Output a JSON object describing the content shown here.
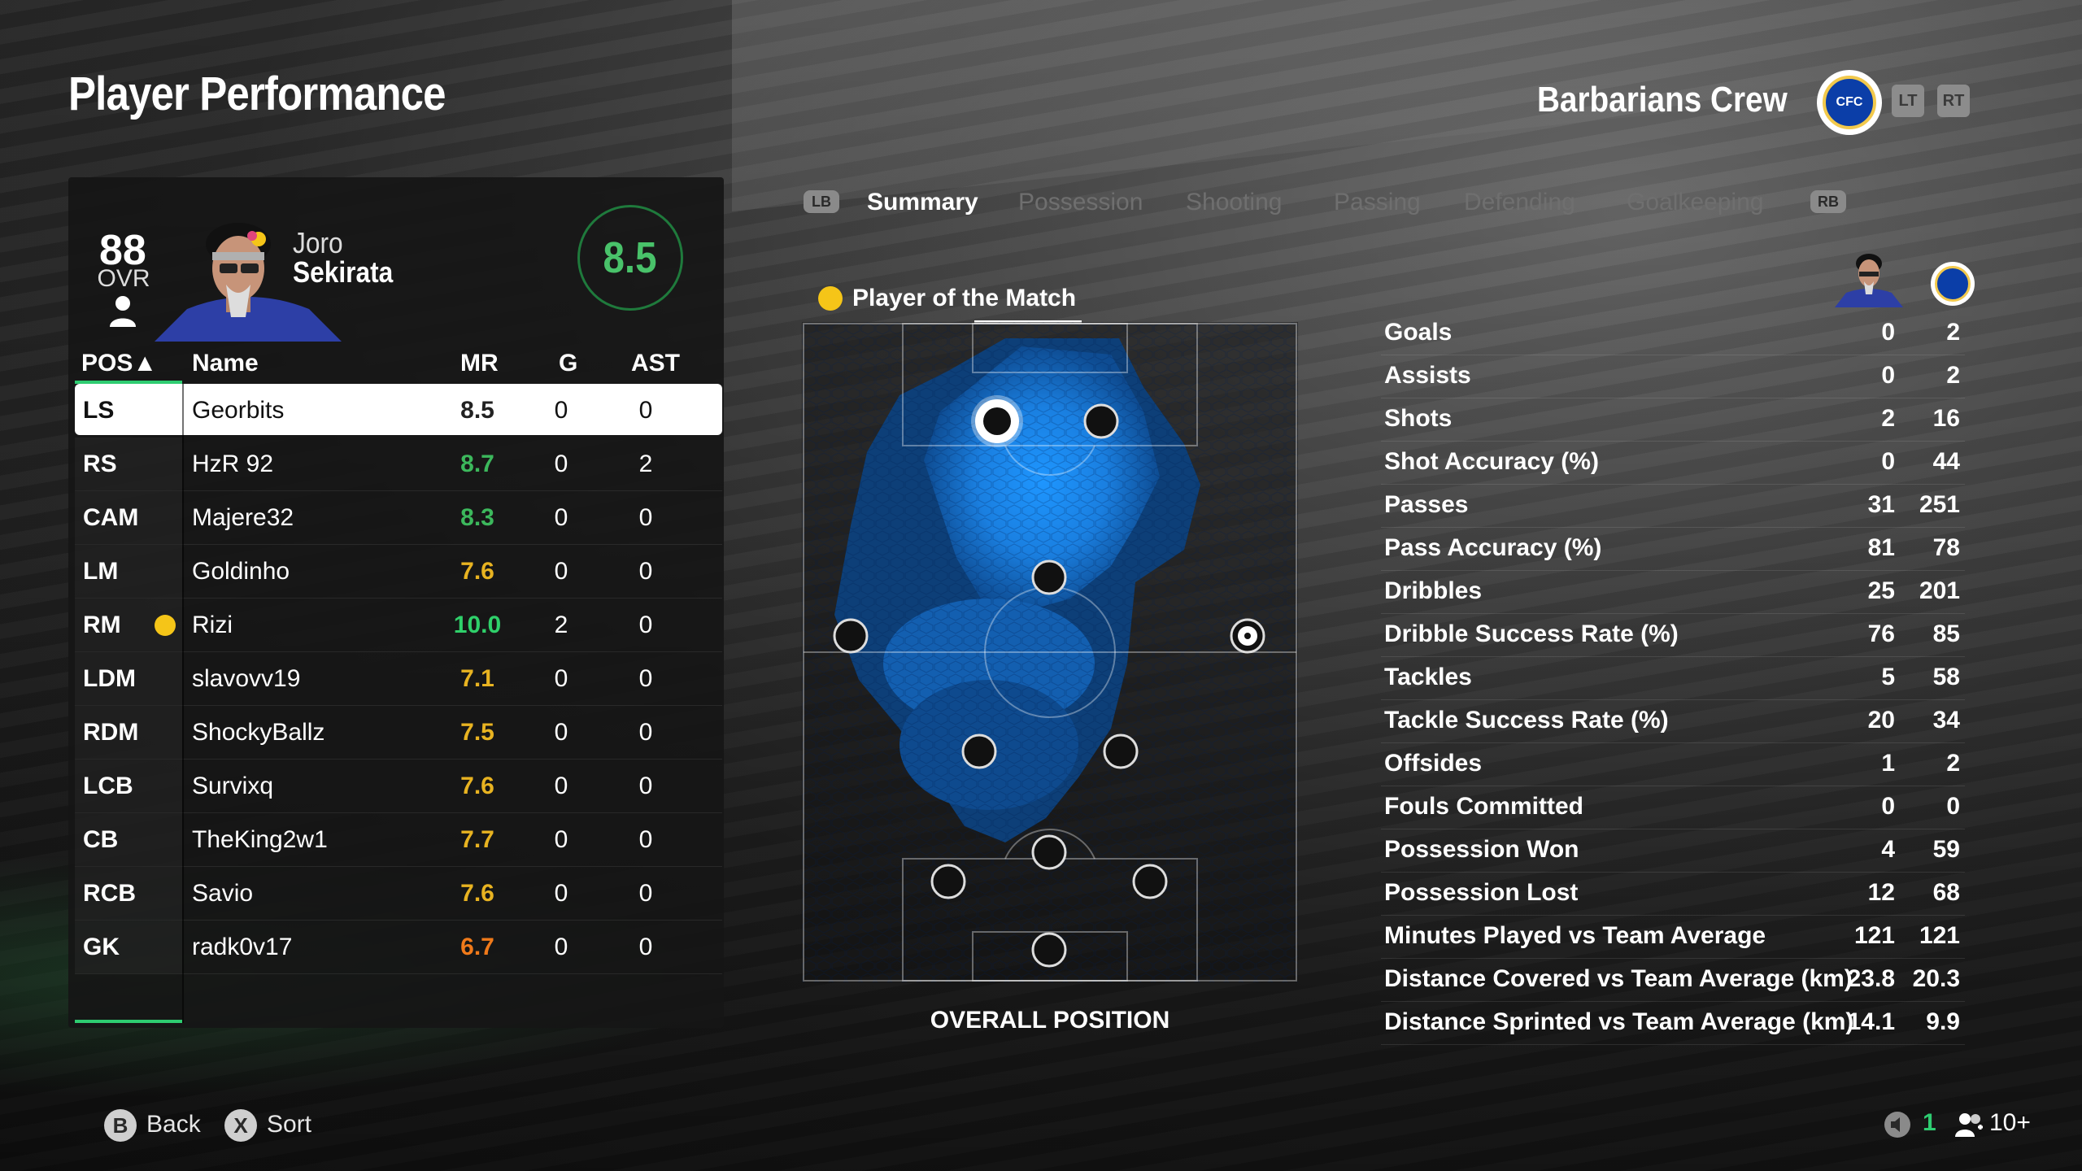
{
  "page": {
    "title": "Player Performance"
  },
  "team": {
    "name": "Barbarians Crew",
    "crest_label": "CFC",
    "lt": "LT",
    "rt": "RT"
  },
  "player": {
    "ovr": "88",
    "ovr_label": "OVR",
    "first_name": "Joro",
    "last_name": "Sekirata",
    "rating": "8.5"
  },
  "table": {
    "headers": {
      "pos": "POS▲",
      "name": "Name",
      "mr": "MR",
      "g": "G",
      "ast": "AST"
    },
    "rows": [
      {
        "pos": "LS",
        "name": "Georbits",
        "mr": "8.5",
        "g": "0",
        "ast": "0",
        "mr_color": "#222222"
      },
      {
        "pos": "RS",
        "name": "HzR 92",
        "mr": "8.7",
        "g": "0",
        "ast": "2",
        "mr_color": "#3cb85c"
      },
      {
        "pos": "CAM",
        "name": "Majere32",
        "mr": "8.3",
        "g": "0",
        "ast": "0",
        "mr_color": "#3cb85c"
      },
      {
        "pos": "LM",
        "name": "Goldinho",
        "mr": "7.6",
        "g": "0",
        "ast": "0",
        "mr_color": "#e8b321"
      },
      {
        "pos": "RM",
        "name": "Rizi",
        "mr": "10.0",
        "g": "2",
        "ast": "0",
        "mr_color": "#2fd06a"
      },
      {
        "pos": "LDM",
        "name": "slavovv19",
        "mr": "7.1",
        "g": "0",
        "ast": "0",
        "mr_color": "#e8b321"
      },
      {
        "pos": "RDM",
        "name": "ShockyBallz",
        "mr": "7.5",
        "g": "0",
        "ast": "0",
        "mr_color": "#e8b321"
      },
      {
        "pos": "LCB",
        "name": "Survixq",
        "mr": "7.6",
        "g": "0",
        "ast": "0",
        "mr_color": "#e8b321"
      },
      {
        "pos": "CB",
        "name": "TheKing2w1",
        "mr": "7.7",
        "g": "0",
        "ast": "0",
        "mr_color": "#e8b321"
      },
      {
        "pos": "RCB",
        "name": "Savio",
        "mr": "7.6",
        "g": "0",
        "ast": "0",
        "mr_color": "#e8b321"
      },
      {
        "pos": "GK",
        "name": "radk0v17",
        "mr": "6.7",
        "g": "0",
        "ast": "0",
        "mr_color": "#f07a1a"
      }
    ]
  },
  "tabs": {
    "lb": "LB",
    "rb": "RB",
    "items": [
      "Summary",
      "Possession",
      "Shooting",
      "Passing",
      "Defending",
      "Goalkeeping"
    ],
    "active": "Summary"
  },
  "potm": {
    "label": "Player of the Match"
  },
  "pitch": {
    "caption": "OVERALL POSITION"
  },
  "stats": [
    {
      "label": "Goals",
      "player": "0",
      "team": "2"
    },
    {
      "label": "Assists",
      "player": "0",
      "team": "2"
    },
    {
      "label": "Shots",
      "player": "2",
      "team": "16"
    },
    {
      "label": "Shot Accuracy (%)",
      "player": "0",
      "team": "44"
    },
    {
      "label": "Passes",
      "player": "31",
      "team": "251"
    },
    {
      "label": "Pass Accuracy (%)",
      "player": "81",
      "team": "78"
    },
    {
      "label": "Dribbles",
      "player": "25",
      "team": "201"
    },
    {
      "label": "Dribble Success Rate (%)",
      "player": "76",
      "team": "85"
    },
    {
      "label": "Tackles",
      "player": "5",
      "team": "58"
    },
    {
      "label": "Tackle Success Rate (%)",
      "player": "20",
      "team": "34"
    },
    {
      "label": "Offsides",
      "player": "1",
      "team": "2"
    },
    {
      "label": "Fouls Committed",
      "player": "0",
      "team": "0"
    },
    {
      "label": "Possession Won",
      "player": "4",
      "team": "59"
    },
    {
      "label": "Possession Lost",
      "player": "12",
      "team": "68"
    },
    {
      "label": "Minutes Played vs Team Average",
      "player": "121",
      "team": "121"
    },
    {
      "label": "Distance Covered vs Team Average (km)",
      "player": "23.8",
      "team": "20.3"
    },
    {
      "label": "Distance Sprinted vs Team Average (km)",
      "player": "14.1",
      "team": "9.9"
    }
  ],
  "footer": {
    "back_btn": "B",
    "back_label": "Back",
    "sort_btn": "X",
    "sort_label": "Sort",
    "count": "1",
    "players": "10+"
  },
  "colors": {
    "accent_green": "#2ecc71",
    "heat_blue": "#1e8fff",
    "potm_gold": "#f5c518"
  }
}
